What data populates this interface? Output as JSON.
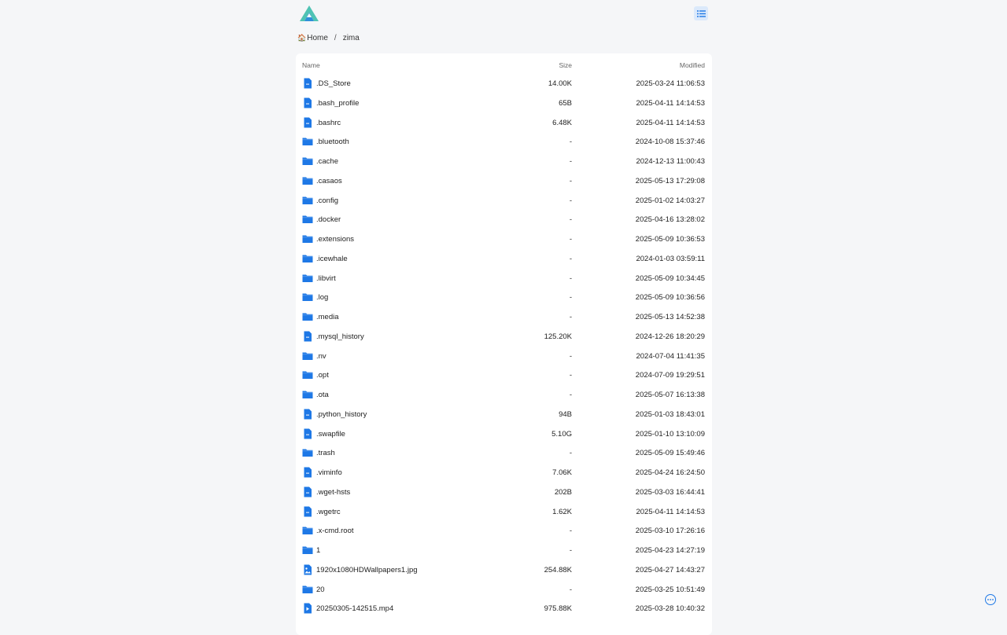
{
  "brand_color": "#1e78e6",
  "breadcrumb": {
    "home_icon": "🏠",
    "home_label": "Home",
    "separator": "/",
    "current": "zima"
  },
  "table": {
    "columns": {
      "name": "Name",
      "size": "Size",
      "modified": "Modified"
    },
    "rows": [
      {
        "type": "file",
        "name": ".DS_Store",
        "size": "14.00K",
        "modified": "2025-03-24 11:06:53"
      },
      {
        "type": "file",
        "name": ".bash_profile",
        "size": "65B",
        "modified": "2025-04-11 14:14:53"
      },
      {
        "type": "file",
        "name": ".bashrc",
        "size": "6.48K",
        "modified": "2025-04-11 14:14:53"
      },
      {
        "type": "folder",
        "name": ".bluetooth",
        "size": "-",
        "modified": "2024-10-08 15:37:46"
      },
      {
        "type": "folder",
        "name": ".cache",
        "size": "-",
        "modified": "2024-12-13 11:00:43"
      },
      {
        "type": "folder",
        "name": ".casaos",
        "size": "-",
        "modified": "2025-05-13 17:29:08"
      },
      {
        "type": "folder",
        "name": ".config",
        "size": "-",
        "modified": "2025-01-02 14:03:27"
      },
      {
        "type": "folder",
        "name": ".docker",
        "size": "-",
        "modified": "2025-04-16 13:28:02"
      },
      {
        "type": "folder",
        "name": ".extensions",
        "size": "-",
        "modified": "2025-05-09 10:36:53"
      },
      {
        "type": "folder",
        "name": ".icewhale",
        "size": "-",
        "modified": "2024-01-03 03:59:11"
      },
      {
        "type": "folder",
        "name": ".libvirt",
        "size": "-",
        "modified": "2025-05-09 10:34:45"
      },
      {
        "type": "folder",
        "name": ".log",
        "size": "-",
        "modified": "2025-05-09 10:36:56"
      },
      {
        "type": "folder",
        "name": ".media",
        "size": "-",
        "modified": "2025-05-13 14:52:38"
      },
      {
        "type": "file",
        "name": ".mysql_history",
        "size": "125.20K",
        "modified": "2024-12-26 18:20:29"
      },
      {
        "type": "folder",
        "name": ".nv",
        "size": "-",
        "modified": "2024-07-04 11:41:35"
      },
      {
        "type": "folder",
        "name": ".opt",
        "size": "-",
        "modified": "2024-07-09 19:29:51"
      },
      {
        "type": "folder",
        "name": ".ota",
        "size": "-",
        "modified": "2025-05-07 16:13:38"
      },
      {
        "type": "file",
        "name": ".python_history",
        "size": "94B",
        "modified": "2025-01-03 18:43:01"
      },
      {
        "type": "file",
        "name": ".swapfile",
        "size": "5.10G",
        "modified": "2025-01-10 13:10:09"
      },
      {
        "type": "folder",
        "name": ".trash",
        "size": "-",
        "modified": "2025-05-09 15:49:46"
      },
      {
        "type": "file",
        "name": ".viminfo",
        "size": "7.06K",
        "modified": "2025-04-24 16:24:50"
      },
      {
        "type": "file",
        "name": ".wget-hsts",
        "size": "202B",
        "modified": "2025-03-03 16:44:41"
      },
      {
        "type": "file",
        "name": ".wgetrc",
        "size": "1.62K",
        "modified": "2025-04-11 14:14:53"
      },
      {
        "type": "folder",
        "name": ".x-cmd.root",
        "size": "-",
        "modified": "2025-03-10 17:26:16"
      },
      {
        "type": "folder",
        "name": "1",
        "size": "-",
        "modified": "2025-04-23 14:27:19"
      },
      {
        "type": "image",
        "name": "1920x1080HDWallpapers1.jpg",
        "size": "254.88K",
        "modified": "2025-04-27 14:43:27"
      },
      {
        "type": "folder",
        "name": "20",
        "size": "-",
        "modified": "2025-03-25 10:51:49"
      },
      {
        "type": "video",
        "name": "20250305-142515.mp4",
        "size": "975.88K",
        "modified": "2025-03-28 10:40:32"
      }
    ]
  }
}
